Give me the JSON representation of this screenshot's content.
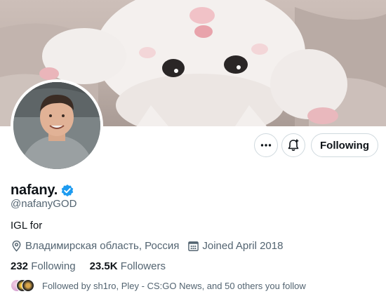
{
  "profile": {
    "display_name": "nafany.",
    "verified": true,
    "handle": "@nafanyGOD",
    "bio": "IGL for",
    "location": "Владимирская область, Россия",
    "joined": "Joined April 2018",
    "following_count": "232",
    "following_label": "Following",
    "followers_count": "23.5K",
    "followers_label": "Followers",
    "followed_by": "Followed by sh1ro, Pley - CS:GO News, and 50 others you follow"
  },
  "actions": {
    "following_button_label": "Following"
  },
  "icons": {
    "more": "more-icon",
    "notify": "bell-plus-icon",
    "verified": "verified-badge-icon",
    "location": "location-pin-icon",
    "calendar": "calendar-icon"
  },
  "colors": {
    "verified_blue": "#1d9bf0",
    "text_primary": "#0f1419",
    "text_secondary": "#536471",
    "border": "#cfd9de"
  }
}
